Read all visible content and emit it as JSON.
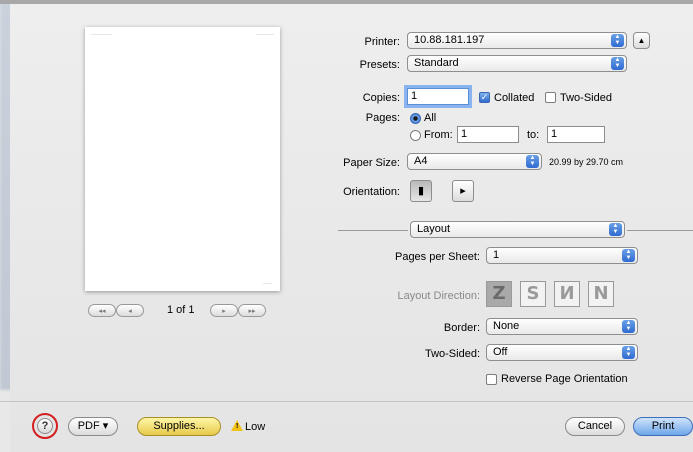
{
  "printer": {
    "label": "Printer:",
    "value": "10.88.181.197"
  },
  "presets": {
    "label": "Presets:",
    "value": "Standard"
  },
  "copies": {
    "label": "Copies:",
    "value": "1",
    "collated_label": "Collated",
    "collated": true,
    "two_sided_label": "Two-Sided",
    "two_sided": false
  },
  "pages": {
    "label": "Pages:",
    "all_label": "All",
    "from_label": "From:",
    "from_value": "1",
    "to_label": "to:",
    "to_value": "1"
  },
  "paper_size": {
    "label": "Paper Size:",
    "value": "A4",
    "dimensions": "20.99 by 29.70 cm"
  },
  "orientation": {
    "label": "Orientation:"
  },
  "section": {
    "value": "Layout"
  },
  "layout": {
    "pages_per_sheet_label": "Pages per Sheet:",
    "pages_per_sheet": "1",
    "direction_label": "Layout Direction:",
    "direction_options": [
      "Z",
      "S",
      "И",
      "N"
    ],
    "border_label": "Border:",
    "border": "None",
    "two_sided_label": "Two-Sided:",
    "two_sided": "Off",
    "reverse_label": "Reverse Page Orientation",
    "reverse": false
  },
  "preview": {
    "page_indicator": "1 of 1",
    "nav_first": "◂◂",
    "nav_prev": "◂",
    "nav_next": "▸",
    "nav_last": "▸▸"
  },
  "footer": {
    "help": "?",
    "pdf": "PDF ▾",
    "supplies": "Supplies...",
    "supply_status": "Low",
    "cancel": "Cancel",
    "print": "Print"
  }
}
